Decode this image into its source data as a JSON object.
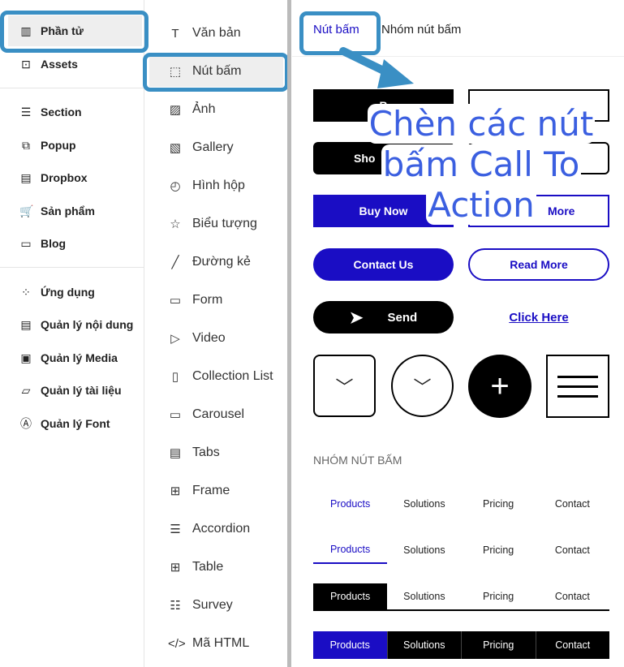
{
  "sidebar": {
    "items": [
      {
        "label": "Phần tử",
        "icon": "elements-icon"
      },
      {
        "label": "Assets",
        "icon": "bookmark-icon"
      },
      {
        "label": "Section",
        "icon": "section-icon"
      },
      {
        "label": "Popup",
        "icon": "popup-icon"
      },
      {
        "label": "Dropbox",
        "icon": "dropbox-icon"
      },
      {
        "label": "Sản phẩm",
        "icon": "cart-icon"
      },
      {
        "label": "Blog",
        "icon": "blog-icon"
      },
      {
        "label": "Ứng dụng",
        "icon": "apps-icon"
      },
      {
        "label": "Quản lý nội dung",
        "icon": "content-icon"
      },
      {
        "label": "Quản lý Media",
        "icon": "media-icon"
      },
      {
        "label": "Quản lý tài liệu",
        "icon": "folder-icon"
      },
      {
        "label": "Quản lý Font",
        "icon": "font-icon"
      }
    ]
  },
  "elements": {
    "items": [
      "Văn bản",
      "Nút bấm",
      "Ảnh",
      "Gallery",
      "Hình hộp",
      "Biểu tượng",
      "Đường kẻ",
      "Form",
      "Video",
      "Collection List",
      "Carousel",
      "Tabs",
      "Frame",
      "Accordion",
      "Table",
      "Survey",
      "Mã HTML"
    ]
  },
  "tabs": [
    "Nút bấm",
    "Nhóm nút bấm"
  ],
  "buttons": {
    "b1": "B",
    "b2": "Sho",
    "buy": "Buy Now",
    "more": "More",
    "contact": "Contact Us",
    "read": "Read More",
    "send": "Send",
    "click": "Click Here"
  },
  "group_title": "NHÓM NÚT BẤM",
  "group": [
    "Products",
    "Solutions",
    "Pricing",
    "Contact"
  ],
  "overlay": "Chèn các nút bấm Call To Action",
  "colors": {
    "accent": "#1a0dc4",
    "highlight": "#3a8fc4",
    "overlay_text": "#3b5fe0"
  }
}
